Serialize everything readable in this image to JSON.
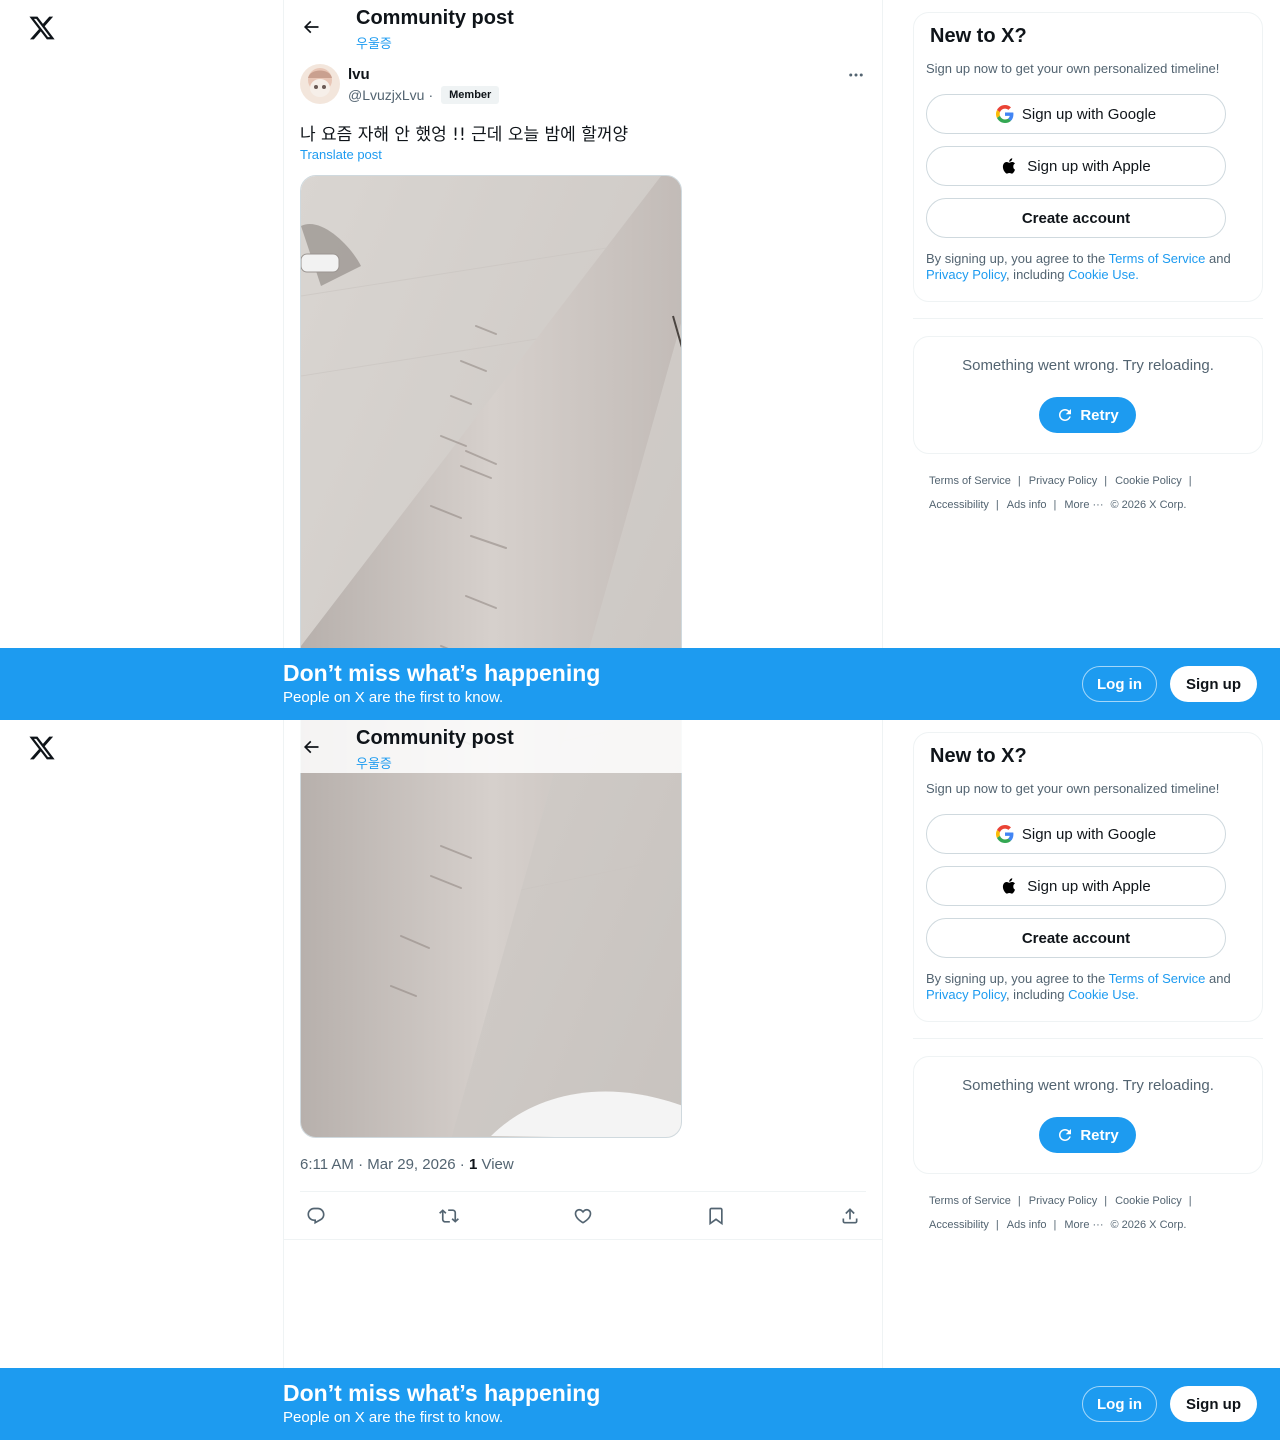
{
  "header": {
    "title": "Community post",
    "community": "우울증"
  },
  "post": {
    "author_name": "lvu",
    "author_handle": "@LvuzjxLvu",
    "handle_separator": "·",
    "badge": "Member",
    "text": "나 요즘 자해 안 했엉 !! 근데 오늘 밤에 할꺼양",
    "translate_label": "Translate post",
    "time": "6:11 AM · Mar 29, 2026 · ",
    "views_count": "1",
    "views_label": " View"
  },
  "sidebar": {
    "new_title": "New to X?",
    "new_sub": "Sign up now to get your own personalized timeline!",
    "google_label": "Sign up with Google",
    "apple_label": "Sign up with Apple",
    "create_label": "Create account",
    "terms_prefix": "By signing up, you agree to the ",
    "terms_link": "Terms of Service",
    "terms_and": " and",
    "privacy_link": "Privacy Policy",
    "including": ", including ",
    "cookie_link": "Cookie Use.",
    "error_text": "Something went wrong. Try reloading.",
    "retry_label": "Retry"
  },
  "footer": {
    "row1": [
      "Terms of Service",
      "Privacy Policy",
      "Cookie Policy"
    ],
    "row2": [
      "Accessibility",
      "Ads info",
      "More ···"
    ],
    "copyright": "© 2026 X Corp."
  },
  "banner": {
    "title": "Don’t miss what’s happening",
    "subtitle": "People on X are the first to know.",
    "login_label": "Log in",
    "signup_label": "Sign up"
  },
  "colors": {
    "accent": "#1d9bf0",
    "text": "#0f1419",
    "muted": "#536471"
  },
  "icons": [
    "x-logo-icon",
    "back-arrow-icon",
    "more-icon",
    "reply-icon",
    "repost-icon",
    "like-icon",
    "bookmark-icon",
    "share-icon",
    "google-icon",
    "apple-icon",
    "refresh-icon"
  ]
}
